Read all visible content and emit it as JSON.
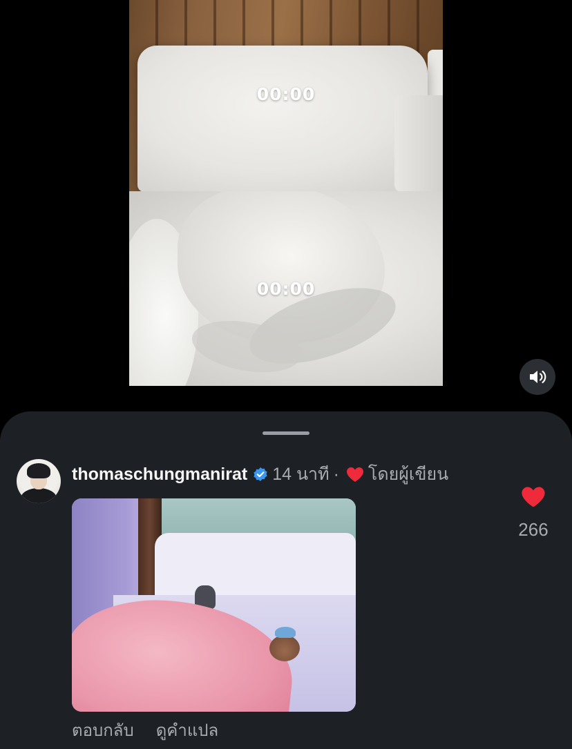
{
  "video": {
    "timer_top": "00:00",
    "timer_bottom": "00:00"
  },
  "controls": {
    "sound_icon": "speaker-icon"
  },
  "comment": {
    "username": "thomaschungmanirat",
    "verified": true,
    "time_ago": "14 นาที",
    "separator": "·",
    "liked_by_author_label": "โดยผู้เขียน",
    "like_count": "266",
    "reply_label": "ตอบกลับ",
    "translate_label": "ดูคำแปล"
  },
  "colors": {
    "sheet_background": "#1d2024",
    "heart": "#ee2a3b",
    "verified_badge": "#3897f0",
    "muted_text": "#a8abb0"
  }
}
